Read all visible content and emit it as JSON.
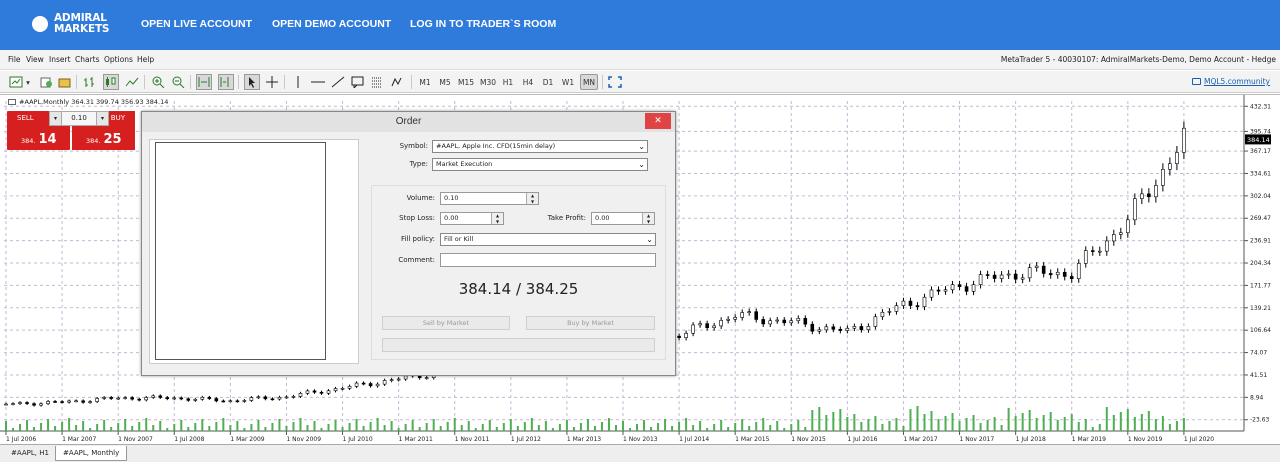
{
  "header": {
    "logo_line1": "ADMIRAL",
    "logo_line2": "MARKETS",
    "nav": [
      "OPEN LIVE ACCOUNT",
      "OPEN DEMO ACCOUNT",
      "LOG IN TO TRADER`S ROOM"
    ]
  },
  "menu": {
    "items": [
      "File",
      "View",
      "Insert",
      "Charts",
      "Options",
      "Help"
    ],
    "account": "MetaTrader 5 - 40030107: AdmiralMarkets-Demo, Demo Account - Hedge"
  },
  "toolbar": {
    "timeframes": [
      "M1",
      "M5",
      "M15",
      "M30",
      "H1",
      "H4",
      "D1",
      "W1",
      "MN"
    ],
    "active_timeframe": "MN",
    "mql_link": "MQL5.community"
  },
  "chart_info": "#AAPL,Monthly  364.31 399.74 356.93 384.14",
  "one_click": {
    "sell_label": "SELL",
    "buy_label": "BUY",
    "volume": "0.10",
    "sell_price_small": "384.",
    "sell_price_big": "14",
    "buy_price_small": "384.",
    "buy_price_big": "25"
  },
  "order_dialog": {
    "title": "Order",
    "symbol_label": "Symbol:",
    "symbol_value": "#AAPL, Apple Inc. CFD(15min delay)",
    "type_label": "Type:",
    "type_value": "Market Execution",
    "volume_label": "Volume:",
    "volume_value": "0.10",
    "stop_loss_label": "Stop Loss:",
    "stop_loss_value": "0.00",
    "take_profit_label": "Take Profit:",
    "take_profit_value": "0.00",
    "fill_policy_label": "Fill policy:",
    "fill_policy_value": "Fill or Kill",
    "comment_label": "Comment:",
    "comment_value": "",
    "price": "384.14 / 384.25",
    "sell_button": "Sell by Market",
    "buy_button": "Buy by Market"
  },
  "tabs": [
    "#AAPL, H1",
    "#AAPL, Monthly"
  ],
  "active_tab": "#AAPL, Monthly",
  "chart_data": {
    "type": "candlestick",
    "symbol": "#AAPL",
    "timeframe": "Monthly",
    "last_price": "384.14",
    "price_axis": [
      "432.31",
      "395.74",
      "367.17",
      "334.61",
      "302.04",
      "269.47",
      "236.91",
      "204.34",
      "171.77",
      "139.21",
      "106.64",
      "74.07",
      "41.51",
      "8.94",
      "-23.63"
    ],
    "time_axis": [
      "1 Jul 2006",
      "1 Mar 2007",
      "1 Nov 2007",
      "1 Jul 2008",
      "1 Mar 2009",
      "1 Nov 2009",
      "1 Jul 2010",
      "1 Mar 2011",
      "1 Nov 2011",
      "1 Jul 2012",
      "1 Mar 2013",
      "1 Nov 2013",
      "1 Jul 2014",
      "1 Mar 2015",
      "1 Nov 2015",
      "1 Jul 2016",
      "1 Mar 2017",
      "1 Nov 2017",
      "1 Jul 2018",
      "1 Mar 2019",
      "1 Nov 2019",
      "1 Jul 2020"
    ],
    "y_range": [
      -40,
      440
    ],
    "series": [
      {
        "x": "Jul 2006",
        "y": -1
      },
      {
        "x": "Mar 2007",
        "y": 2
      },
      {
        "x": "Nov 2007",
        "y": 8
      },
      {
        "x": "Jul 2008",
        "y": 8
      },
      {
        "x": "Mar 2009",
        "y": 4
      },
      {
        "x": "Nov 2009",
        "y": 10
      },
      {
        "x": "Jul 2014",
        "y": 100
      },
      {
        "x": "Mar 2015",
        "y": 128
      },
      {
        "x": "Nov 2015",
        "y": 118
      },
      {
        "x": "Jul 2016",
        "y": 104
      },
      {
        "x": "Mar 2017",
        "y": 144
      },
      {
        "x": "Nov 2017",
        "y": 172
      },
      {
        "x": "Jul 2018",
        "y": 190
      },
      {
        "x": "Mar 2019",
        "y": 190
      },
      {
        "x": "Nov 2019",
        "y": 267
      },
      {
        "x": "Jul 2020",
        "y": 384
      }
    ]
  }
}
